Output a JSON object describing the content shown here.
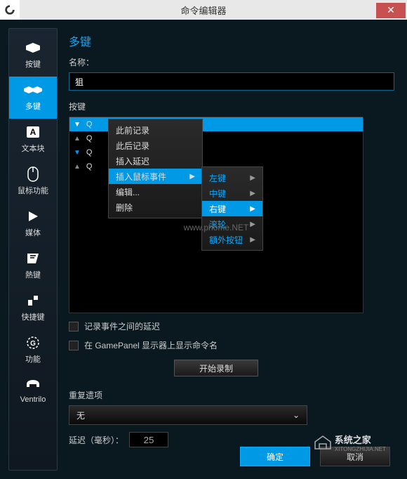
{
  "window": {
    "title": "命令编辑器",
    "close": "✕"
  },
  "sidebar": {
    "items": [
      {
        "label": "按键"
      },
      {
        "label": "多键"
      },
      {
        "label": "文本块"
      },
      {
        "label": "鼠标功能"
      },
      {
        "label": "媒体"
      },
      {
        "label": "熱键"
      },
      {
        "label": "快捷键"
      },
      {
        "label": "功能"
      },
      {
        "label": "Ventrilo"
      }
    ]
  },
  "main": {
    "title": "多键",
    "name_label": "名称：",
    "name_value": "狙",
    "keystroke_label": "按键",
    "key_letter": "Q",
    "context_menu": [
      {
        "label": "此前记录"
      },
      {
        "label": "此后记录"
      },
      {
        "label": "插入延迟"
      },
      {
        "label": "插入鼠标事件",
        "has_sub": true
      },
      {
        "label": "编辑..."
      },
      {
        "label": "删除"
      }
    ],
    "submenu": [
      {
        "label": "左键"
      },
      {
        "label": "中键"
      },
      {
        "label": "右键"
      },
      {
        "label": "滚轮"
      },
      {
        "label": "額外按钮"
      }
    ],
    "checkbox1": "记录事件之间的延迟",
    "checkbox2": "在 GamePanel 显示器上显示命令名",
    "record_btn": "开始录制",
    "repeat_label": "重复遗项",
    "repeat_value": "无",
    "delay_label": "延迟（毫秒）：",
    "delay_value": "25",
    "ok_btn": "确定",
    "cancel_btn": "取消"
  },
  "watermarks": {
    "wm1": "www.phome.NET",
    "wm2_brand": "系统之家",
    "wm2_url": "XITONGZHIJIA.NET"
  }
}
